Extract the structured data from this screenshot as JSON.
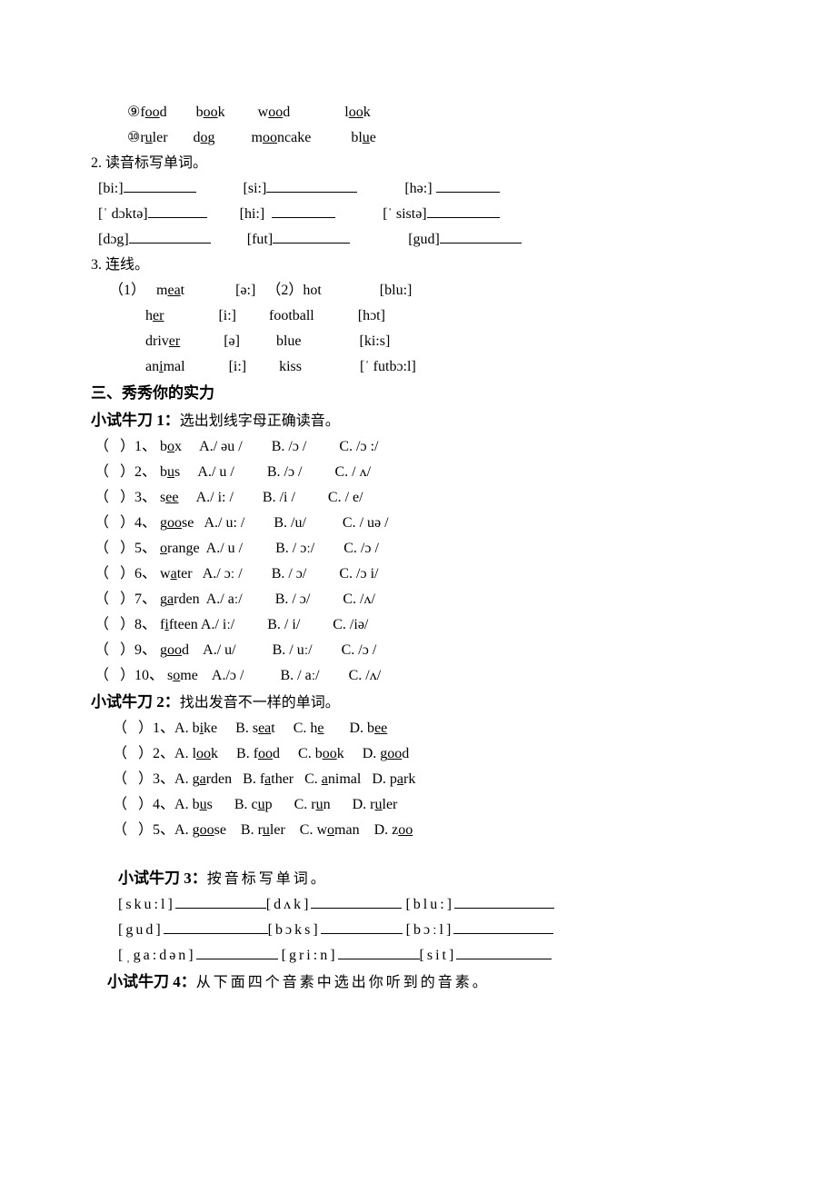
{
  "top_rows": {
    "r9": {
      "num": "⑨",
      "w1p": "f",
      "w1u": "oo",
      "w1s": "d",
      "w2p": "b",
      "w2u": "oo",
      "w2s": "k",
      "w3p": "w",
      "w3u": "oo",
      "w3s": "d",
      "w4p": "l",
      "w4u": "oo",
      "w4s": "k"
    },
    "r10": {
      "num": "⑩",
      "w1p": "r",
      "w1u": "u",
      "w1s": "ler",
      "w2p": "d",
      "w2u": "o",
      "w2s": "g",
      "w3p": "m",
      "w3u": "oo",
      "w3s": "ncake",
      "w4p": "bl",
      "w4u": "u",
      "w4s": "e"
    }
  },
  "sec2": {
    "title": "2. 读音标写单词。",
    "r1": {
      "a": "[bi:]",
      "b": "[si:]",
      "c": "[hə:]"
    },
    "r2": {
      "a": "[ˈ dɔktə]",
      "b": "[hi:]",
      "c": "[ˈ sistə]"
    },
    "r3": {
      "a": "[dɔg]",
      "b": "[fut]",
      "c": "[gud]"
    }
  },
  "sec3": {
    "title": "3. 连线。",
    "r1": {
      "left_num": "（1）",
      "lw_pre": "m",
      "lw_u": "ea",
      "lw_suf": "t",
      "lp": "[ə:]",
      "right_num": "（2）",
      "rw": "hot",
      "rp": "[blu:]"
    },
    "r2": {
      "lw_pre": "h",
      "lw_u": "er",
      "lw_suf": "",
      "lp": "[i:]",
      "rw": "football",
      "rp": "[hɔt]"
    },
    "r3": {
      "lw_pre": "driv",
      "lw_u": "er",
      "lw_suf": "",
      "lp": "[ə]",
      "rw": "blue",
      "rp": "[ki:s]"
    },
    "r4": {
      "lw_pre": "an",
      "lw_u": "i",
      "lw_suf": "mal",
      "lp": "[i:]",
      "rw": "kiss",
      "rp": "[ˈ futbɔ:l]"
    }
  },
  "sec_iii": {
    "title": "三、秀秀你的实力"
  },
  "try1": {
    "title_bold": "小试牛刀 1：",
    "title_rest": "选出划线字母正确读音。",
    "rows": [
      {
        "n": "1",
        "wp": "b",
        "wu": "o",
        "ws": "x",
        "a": "A./ əu /",
        "b": "B. /ɔ /",
        "c": "C. /ɔ :/"
      },
      {
        "n": "2",
        "wp": "b",
        "wu": "u",
        "ws": "s",
        "a": "A./ u /",
        "b": "B. /ɔ /",
        "c": "C. / ʌ/"
      },
      {
        "n": "3",
        "wp": "s",
        "wu": "ee",
        "ws": "",
        "a": "A./ i: /",
        "b": "B. /i /",
        "c": "C. / e/"
      },
      {
        "n": "4",
        "wp": "g",
        "wu": "oo",
        "ws": "se",
        "a": "A./ u: /",
        "b": "B. /u/",
        "c": "C. / uə /"
      },
      {
        "n": "5",
        "wp": "",
        "wu": "o",
        "ws": "range",
        "a": "A./ u /",
        "b": "B. / ɔː/",
        "c": "C. /ɔ /"
      },
      {
        "n": "6",
        "wp": "w",
        "wu": "a",
        "ws": "ter",
        "a": "A./ ɔː /",
        "b": "B. / ɔ/",
        "c": "C. /ɔ i/"
      },
      {
        "n": "7",
        "wp": "g",
        "wu": "a",
        "ws": "rden",
        "a": "A./ aː/",
        "b": "B. / ɔ/",
        "c": "C. /ʌ/"
      },
      {
        "n": "8",
        "wp": "f",
        "wu": "i",
        "ws": "fteen",
        "a": "A./ iː/",
        "b": "B. / i/",
        "c": "C. /iə/"
      },
      {
        "n": "9",
        "wp": "g",
        "wu": "oo",
        "ws": "d",
        "a": "A./ u/",
        "b": "B. / uː/",
        "c": "C. /ɔ /"
      },
      {
        "n": "10",
        "wp": "s",
        "wu": "o",
        "ws": "me",
        "a": "A./ɔ /",
        "b": "B. / aː/",
        "c": "C. /ʌ/"
      }
    ]
  },
  "try2": {
    "title_bold": "小试牛刀 2：",
    "title_rest": "找出发音不一样的单词。",
    "rows": [
      {
        "n": "1",
        "a_p": "A. b",
        "a_u": "i",
        "a_s": "ke",
        "b_p": "B. s",
        "b_u": "ea",
        "b_s": "t",
        "c_p": "C. h",
        "c_u": "e",
        "c_s": "",
        "d_p": "D. b",
        "d_u": "ee",
        "d_s": ""
      },
      {
        "n": "2",
        "a_p": "A. l",
        "a_u": "oo",
        "a_s": "k",
        "b_p": "B. f",
        "b_u": "oo",
        "b_s": "d",
        "c_p": "C. b",
        "c_u": "oo",
        "c_s": "k",
        "d_p": "D. g",
        "d_u": "oo",
        "d_s": "d"
      },
      {
        "n": "3",
        "a_p": "A. g",
        "a_u": "a",
        "a_s": "rden",
        "b_p": "B. f",
        "b_u": "a",
        "b_s": "ther",
        "c_p": "C. ",
        "c_u": "a",
        "c_s": "nimal",
        "d_p": "D. p",
        "d_u": "a",
        "d_s": "rk"
      },
      {
        "n": "4",
        "a_p": "A. b",
        "a_u": "u",
        "a_s": "s",
        "b_p": "B. c",
        "b_u": "u",
        "b_s": "p",
        "c_p": "C. r",
        "c_u": "u",
        "c_s": "n",
        "d_p": "D. r",
        "d_u": "u",
        "d_s": "ler"
      },
      {
        "n": "5",
        "a_p": "A. g",
        "a_u": "oo",
        "a_s": "se",
        "b_p": "B. r",
        "b_u": "u",
        "b_s": "ler",
        "c_p": "C. w",
        "c_u": "o",
        "c_s": "man",
        "d_p": "D. z",
        "d_u": "oo",
        "d_s": ""
      }
    ]
  },
  "try3": {
    "title_bold": "小试牛刀 3：",
    "title_rest": "按音标写单词。",
    "r1": {
      "a": "[sku:l]",
      "b": "[dʌk]",
      "c": "[blu:]"
    },
    "r2": {
      "a": "[gud]",
      "b": "[bɔks]",
      "c": "[bɔːl]"
    },
    "r3": {
      "a": "[ˌga:dən]",
      "b": "[gri:n]",
      "c": "[sit]"
    }
  },
  "try4": {
    "title_bold": "小试牛刀 4：",
    "title_rest": "从下面四个音素中选出你听到的音素。"
  }
}
